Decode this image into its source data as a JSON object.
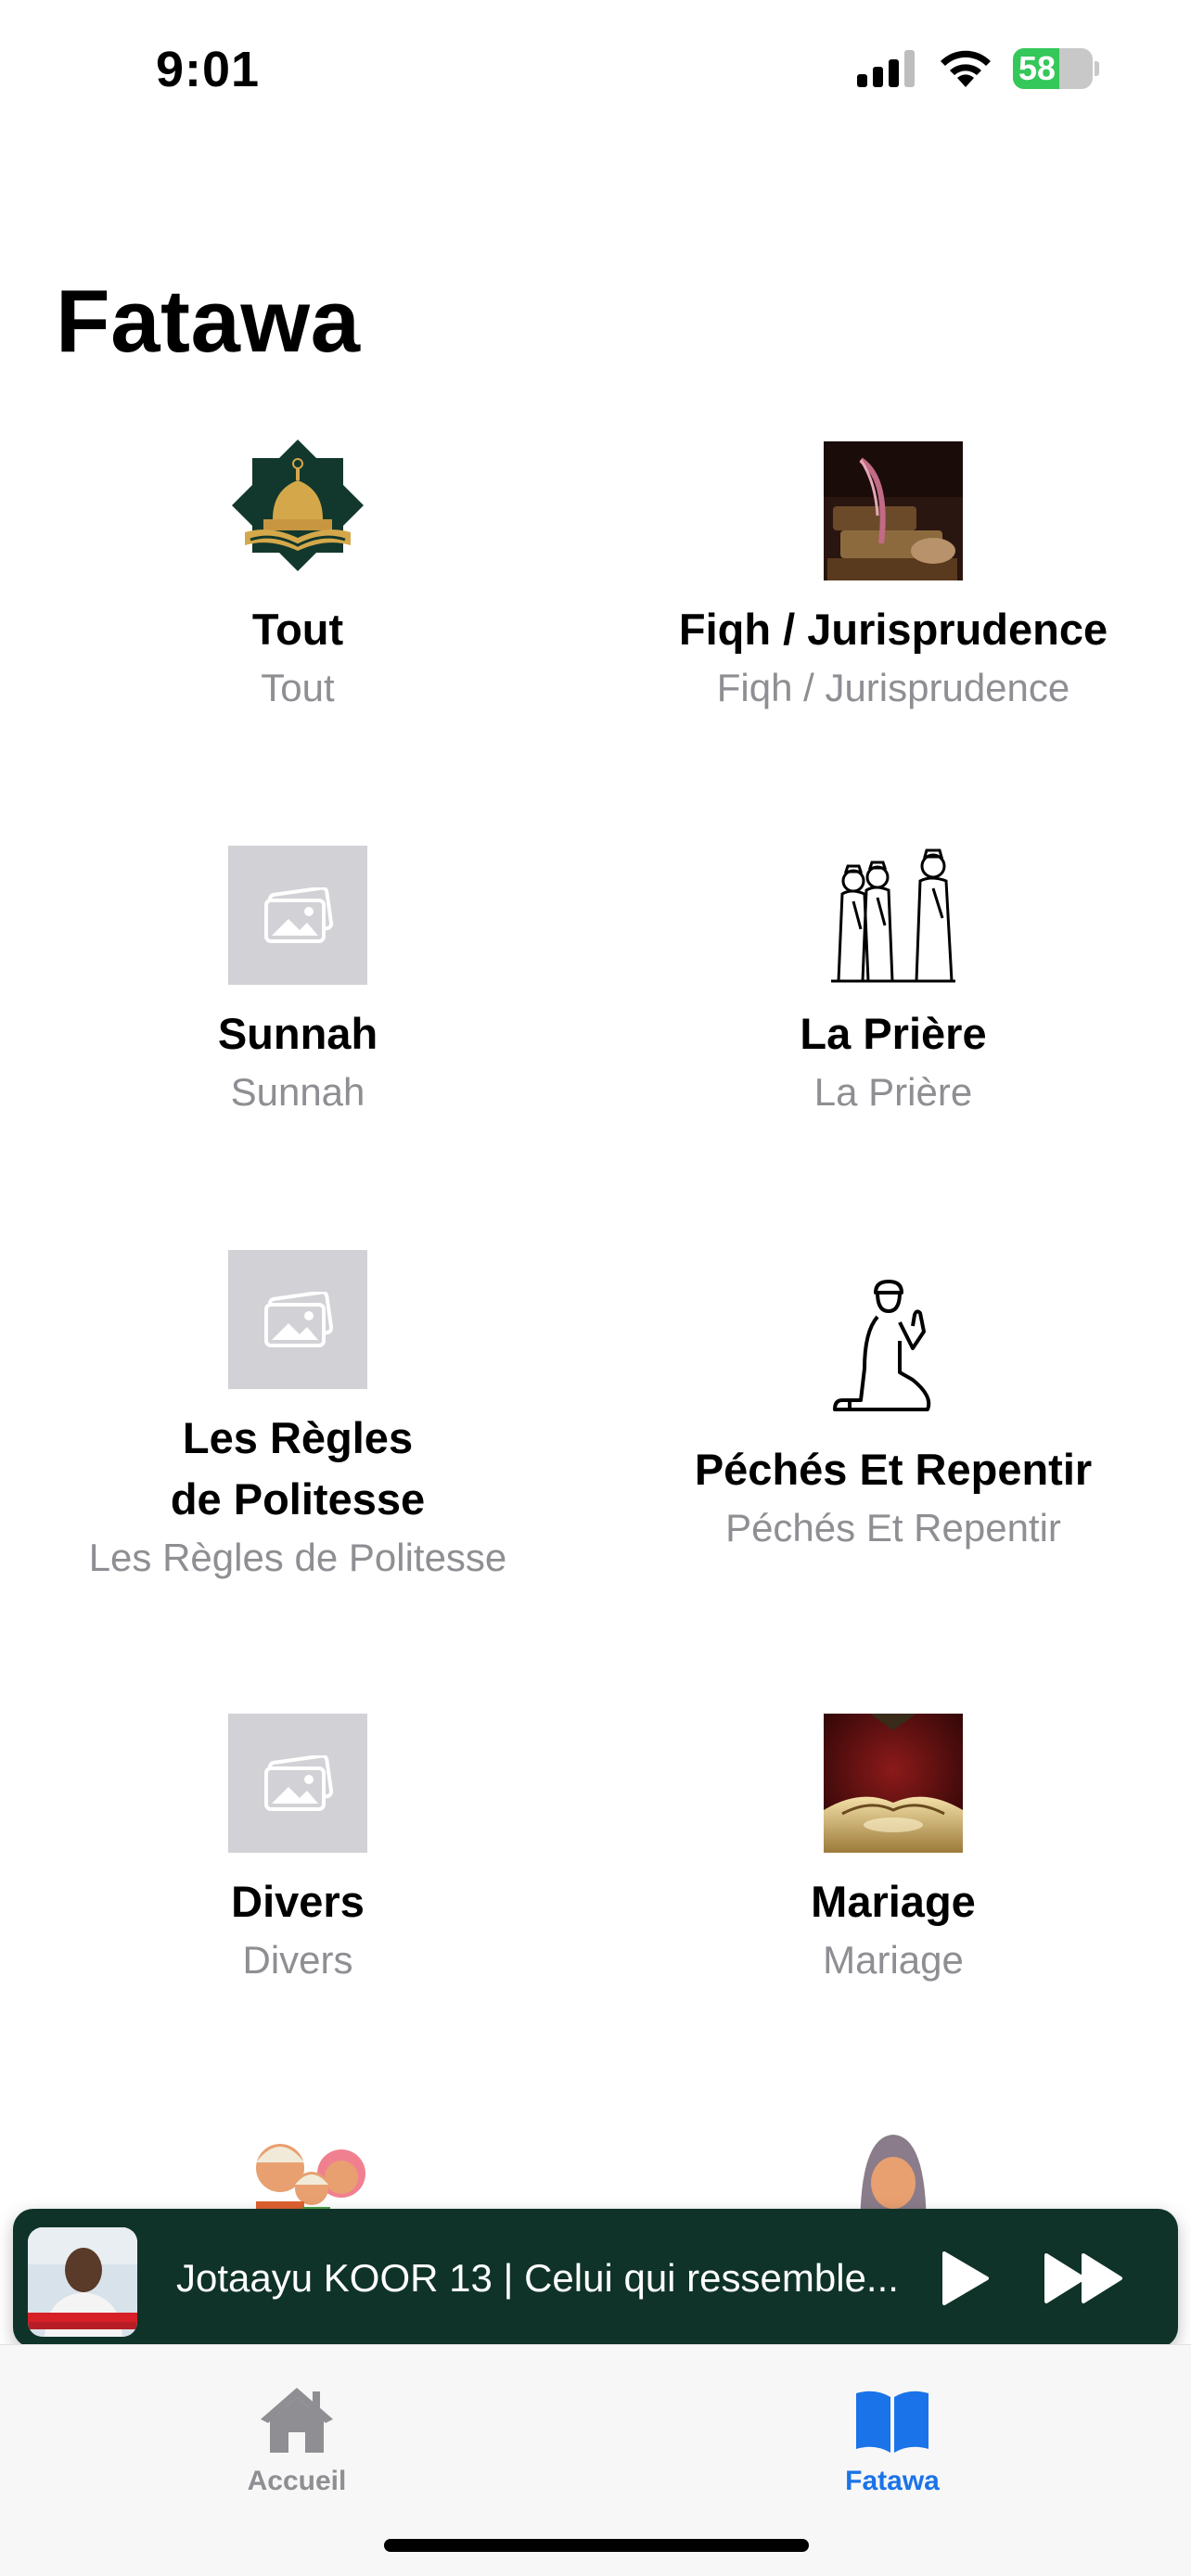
{
  "status_bar": {
    "time": "9:01",
    "battery_percent": 58,
    "battery_label": "58"
  },
  "page": {
    "title": "Fatawa"
  },
  "categories": [
    {
      "title": "Tout",
      "subtitle": "Tout",
      "image": "mosque-book-logo"
    },
    {
      "title": "Fiqh / Jurisprudence",
      "subtitle": "Fiqh / Jurisprudence",
      "image": "quill-and-books-photo"
    },
    {
      "title": "Sunnah",
      "subtitle": "Sunnah",
      "image": "image-placeholder"
    },
    {
      "title": "La Prière",
      "subtitle": "La Prière",
      "image": "praying-men-illustration"
    },
    {
      "title_line1": "Les Règles",
      "title_line2": "de Politesse",
      "subtitle": "Les Règles de Politesse",
      "image": "image-placeholder"
    },
    {
      "title": "Péchés Et Repentir",
      "subtitle": "Péchés Et Repentir",
      "image": "kneeling-prayer-illustration"
    },
    {
      "title": "Divers",
      "subtitle": "Divers",
      "image": "image-placeholder"
    },
    {
      "title": "Mariage",
      "subtitle": "Mariage",
      "image": "ornamental-red-gold-photo"
    },
    {
      "title": "",
      "subtitle": "",
      "image": "family-illustration"
    },
    {
      "title": "",
      "subtitle": "",
      "image": "veiled-woman-illustration"
    }
  ],
  "mini_player": {
    "title": "Jotaayu KOOR 13 | Celui qui ressemble...",
    "artwork": "speaker-thumbnail",
    "play_icon": "play-icon",
    "forward_icon": "fast-forward-icon"
  },
  "tab_bar": {
    "tabs": [
      {
        "label": "Accueil",
        "icon": "house-icon",
        "active": false
      },
      {
        "label": "Fatawa",
        "icon": "book-icon",
        "active": true
      }
    ],
    "active_color": "#1a73e8",
    "inactive_color": "#8e8e93"
  },
  "colors": {
    "player_background": "#0f3328",
    "subtitle": "#8e8e93",
    "accent": "#1a73e8"
  }
}
